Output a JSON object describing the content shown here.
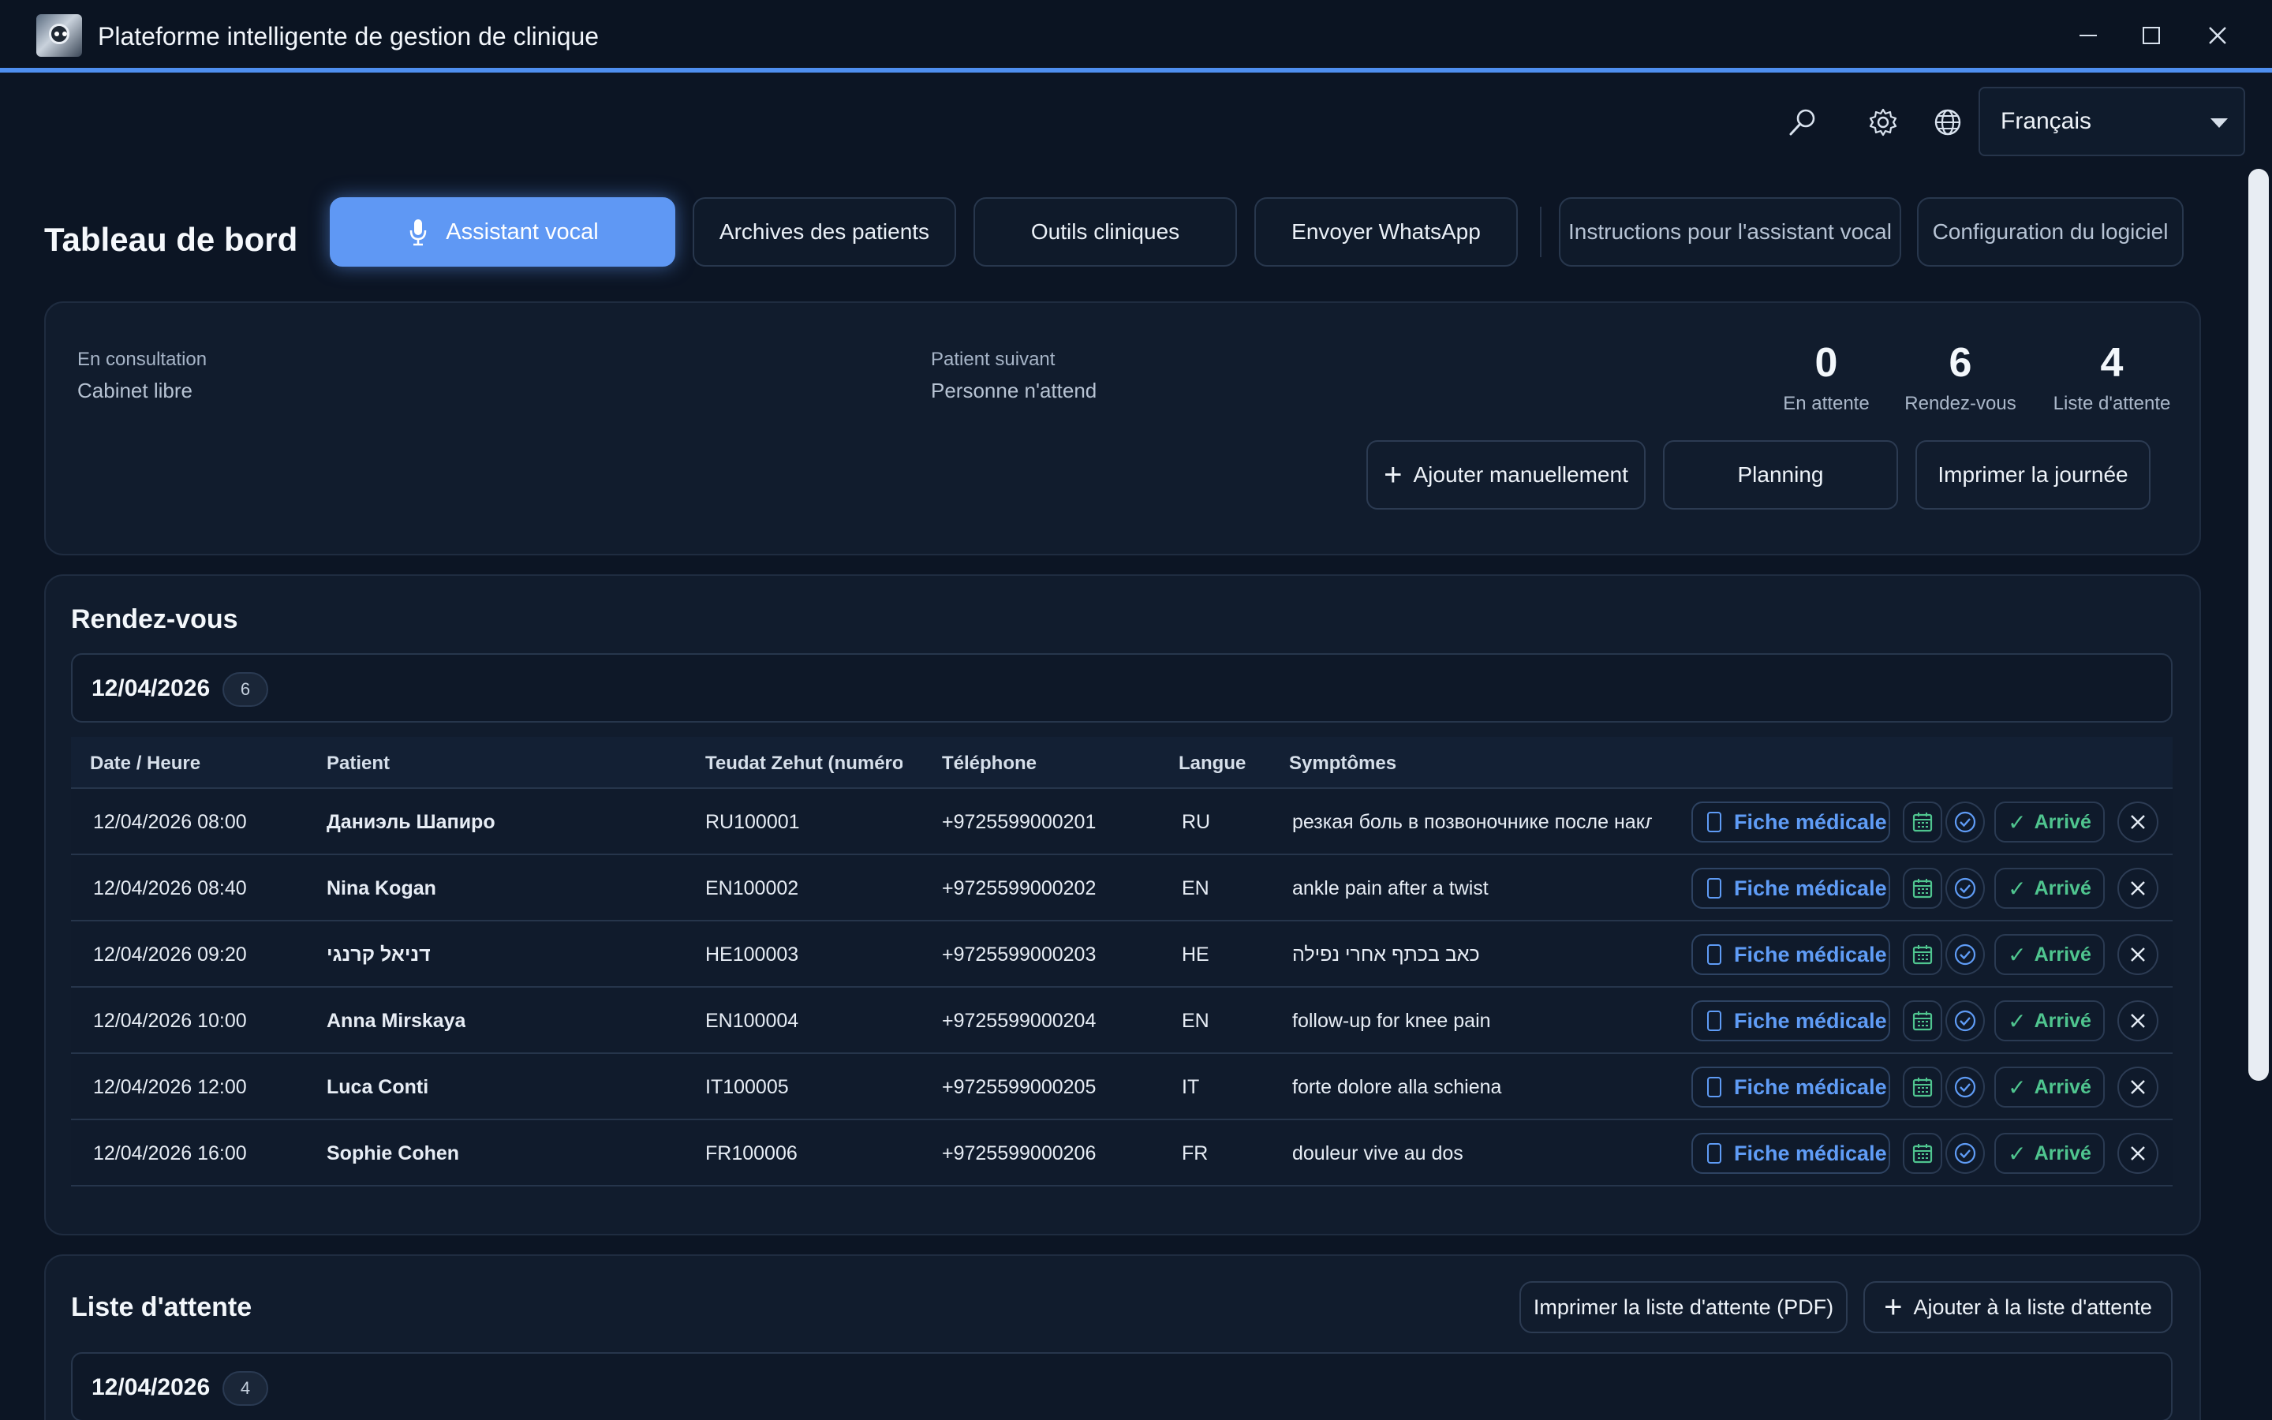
{
  "window": {
    "title": "Plateforme intelligente de gestion de clinique",
    "controls": [
      "minimize",
      "maximize",
      "close"
    ]
  },
  "toolbar": {
    "icons": [
      "search-icon",
      "gear-icon",
      "globe-icon"
    ],
    "language": "Français"
  },
  "header": {
    "title": "Tableau de bord",
    "nav": [
      "Assistant vocal",
      "Archives des patients",
      "Outils cliniques",
      "Envoyer WhatsApp",
      "Instructions pour l'assistant vocal",
      "Configuration du logiciel"
    ]
  },
  "status": {
    "consultation_label": "En consultation",
    "consultation_value": "Cabinet libre",
    "next_label": "Patient suivant",
    "next_value": "Personne n'attend",
    "stats": [
      {
        "value": "0",
        "label": "En attente"
      },
      {
        "value": "6",
        "label": "Rendez-vous"
      },
      {
        "value": "4",
        "label": "Liste d'attente"
      }
    ],
    "actions": {
      "add_manual": "Ajouter manuellement",
      "planning": "Planning",
      "print_day": "Imprimer la journée"
    }
  },
  "appointments": {
    "title": "Rendez-vous",
    "date": "12/04/2026",
    "count": "6",
    "columns": [
      "Date / Heure",
      "Patient",
      "Teudat Zehut (numéro...",
      "Téléphone",
      "Langue",
      "Symptômes"
    ],
    "fiche_label": "Fiche médicale",
    "arrive_label": "Arrivé",
    "rows": [
      {
        "datetime": "12/04/2026 08:00",
        "patient": "Даниэль Шапиро",
        "id": "RU100001",
        "phone": "+9725599000201",
        "lang": "RU",
        "symptoms": "резкая боль в позвоночнике после наклона"
      },
      {
        "datetime": "12/04/2026 08:40",
        "patient": "Nina Kogan",
        "id": "EN100002",
        "phone": "+9725599000202",
        "lang": "EN",
        "symptoms": "ankle pain after a twist"
      },
      {
        "datetime": "12/04/2026 09:20",
        "patient": "דניאל קרנגי",
        "id": "HE100003",
        "phone": "+9725599000203",
        "lang": "HE",
        "symptoms": "כאב בכתף אחרי נפילה"
      },
      {
        "datetime": "12/04/2026 10:00",
        "patient": "Anna Mirskaya",
        "id": "EN100004",
        "phone": "+9725599000204",
        "lang": "EN",
        "symptoms": "follow-up for knee pain"
      },
      {
        "datetime": "12/04/2026 12:00",
        "patient": "Luca Conti",
        "id": "IT100005",
        "phone": "+9725599000205",
        "lang": "IT",
        "symptoms": "forte dolore alla schiena"
      },
      {
        "datetime": "12/04/2026 16:00",
        "patient": "Sophie Cohen",
        "id": "FR100006",
        "phone": "+9725599000206",
        "lang": "FR",
        "symptoms": "douleur vive au dos"
      }
    ]
  },
  "waiting_list": {
    "title": "Liste d'attente",
    "print_label": "Imprimer la liste d'attente (PDF)",
    "add_label": "Ajouter à la liste d'attente",
    "date": "12/04/2026",
    "count": "4"
  },
  "colors": {
    "background": "#0c1524",
    "accent": "#5f98f4",
    "link": "#5f9cf6",
    "success": "#4fc58f",
    "card": "#111c2d"
  }
}
